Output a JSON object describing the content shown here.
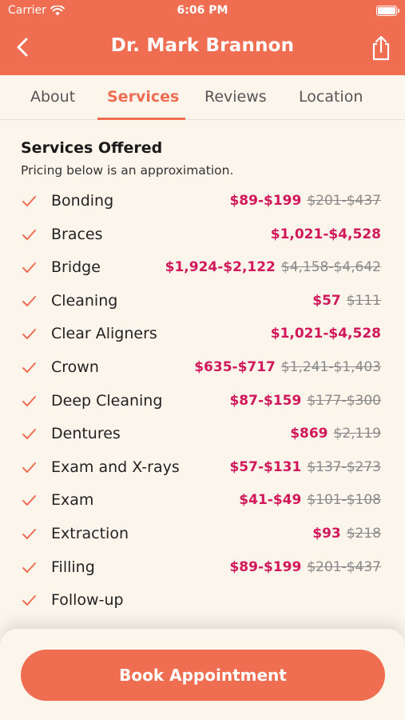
{
  "status_bar": {
    "carrier": "Carrier",
    "time": "6:06 PM"
  },
  "header": {
    "title": "Dr. Mark Brannon"
  },
  "tabs": [
    {
      "label": "About",
      "active": false
    },
    {
      "label": "Services",
      "active": true
    },
    {
      "label": "Reviews",
      "active": false
    },
    {
      "label": "Location",
      "active": false
    }
  ],
  "services": {
    "title": "Services Offered",
    "subtitle": "Pricing below is an approximation.",
    "items": [
      {
        "name": "Bonding",
        "price": "$89-$199",
        "original": "$201-$437"
      },
      {
        "name": "Braces",
        "price": "$1,021-$4,528",
        "original": ""
      },
      {
        "name": "Bridge",
        "price": "$1,924-$2,122",
        "original": "$4,158-$4,642"
      },
      {
        "name": "Cleaning",
        "price": "$57",
        "original": "$111"
      },
      {
        "name": "Clear Aligners",
        "price": "$1,021-$4,528",
        "original": ""
      },
      {
        "name": "Crown",
        "price": "$635-$717",
        "original": "$1,241-$1,403"
      },
      {
        "name": "Deep Cleaning",
        "price": "$87-$159",
        "original": "$177-$300"
      },
      {
        "name": "Dentures",
        "price": "$869",
        "original": "$2,119"
      },
      {
        "name": "Exam and X-rays",
        "price": "$57-$131",
        "original": "$137-$273"
      },
      {
        "name": "Exam",
        "price": "$41-$49",
        "original": "$101-$108"
      },
      {
        "name": "Extraction",
        "price": "$93",
        "original": "$218"
      },
      {
        "name": "Filling",
        "price": "$89-$199",
        "original": "$201-$437"
      },
      {
        "name": "Follow-up",
        "price": "",
        "original": ""
      }
    ]
  },
  "footer": {
    "book_label": "Book Appointment"
  },
  "colors": {
    "accent": "#ef6e52",
    "price": "#d0185b",
    "background": "#fcf5ec"
  }
}
